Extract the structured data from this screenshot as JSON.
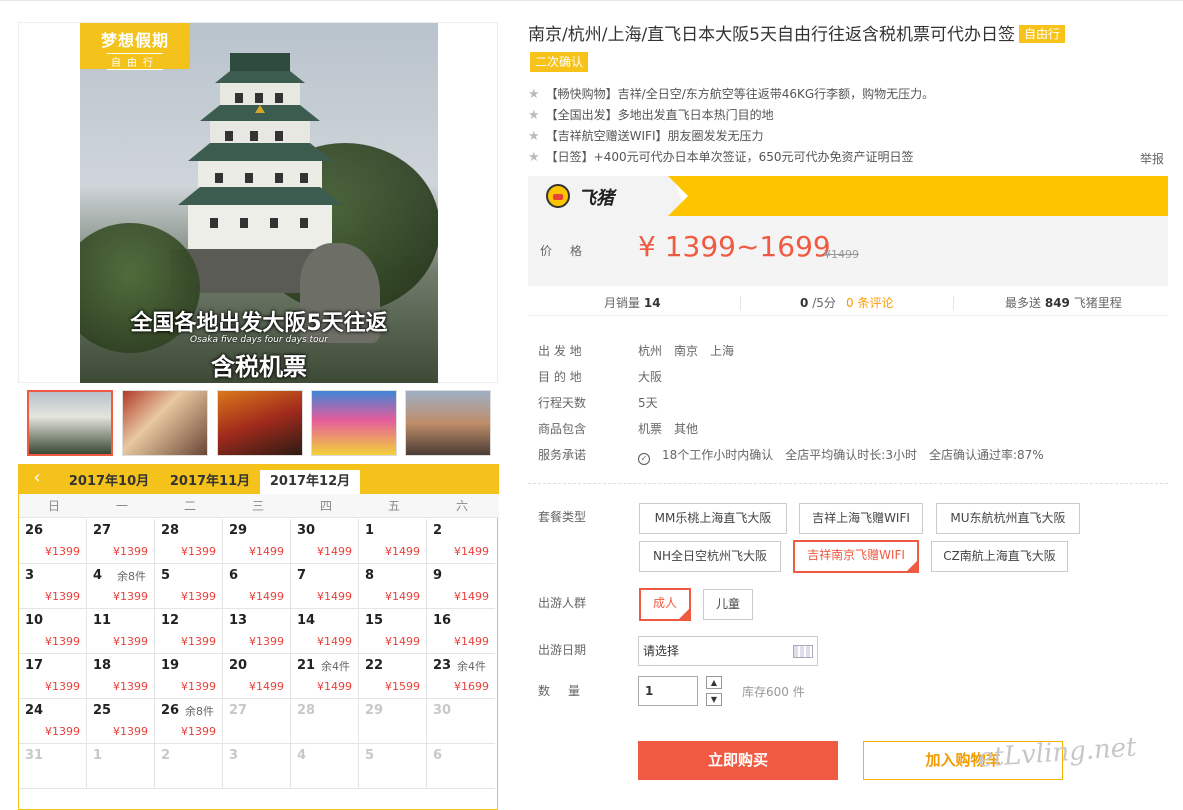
{
  "gallery": {
    "badge_line1": "梦想假期",
    "badge_line2": "自由行",
    "overlay_line1": "全国各地出发大阪5天往返",
    "overlay_line2": "Osaka five days four days tour",
    "overlay_line3": "含税机票"
  },
  "calendar": {
    "prev_icon": "chevron-left-icon",
    "tabs": [
      "2017年10月",
      "2017年11月",
      "2017年12月"
    ],
    "active_tab": "2017年12月",
    "weekdays": [
      "日",
      "一",
      "二",
      "三",
      "四",
      "五",
      "六"
    ],
    "days": [
      {
        "d": "26",
        "price": "¥1399"
      },
      {
        "d": "27",
        "price": "¥1399"
      },
      {
        "d": "28",
        "price": "¥1399"
      },
      {
        "d": "29",
        "price": "¥1499"
      },
      {
        "d": "30",
        "price": "¥1499"
      },
      {
        "d": "1",
        "price": "¥1499"
      },
      {
        "d": "2",
        "price": "¥1499"
      },
      {
        "d": "3",
        "price": "¥1399"
      },
      {
        "d": "4",
        "stock": "余8件",
        "price": "¥1399"
      },
      {
        "d": "5",
        "price": "¥1399"
      },
      {
        "d": "6",
        "price": "¥1499"
      },
      {
        "d": "7",
        "price": "¥1499"
      },
      {
        "d": "8",
        "price": "¥1499"
      },
      {
        "d": "9",
        "price": "¥1499"
      },
      {
        "d": "10",
        "price": "¥1399"
      },
      {
        "d": "11",
        "price": "¥1399"
      },
      {
        "d": "12",
        "price": "¥1399"
      },
      {
        "d": "13",
        "price": "¥1399"
      },
      {
        "d": "14",
        "price": "¥1499"
      },
      {
        "d": "15",
        "price": "¥1499"
      },
      {
        "d": "16",
        "price": "¥1499"
      },
      {
        "d": "17",
        "price": "¥1399"
      },
      {
        "d": "18",
        "price": "¥1399"
      },
      {
        "d": "19",
        "price": "¥1399"
      },
      {
        "d": "20",
        "price": "¥1499"
      },
      {
        "d": "21",
        "stock": "余4件",
        "price": "¥1499"
      },
      {
        "d": "22",
        "price": "¥1599"
      },
      {
        "d": "23",
        "stock": "余4件",
        "price": "¥1699"
      },
      {
        "d": "24",
        "price": "¥1399"
      },
      {
        "d": "25",
        "price": "¥1399"
      },
      {
        "d": "26",
        "stock": "余8件",
        "price": "¥1399"
      },
      {
        "d": "27",
        "disabled": true
      },
      {
        "d": "28",
        "disabled": true
      },
      {
        "d": "29",
        "disabled": true
      },
      {
        "d": "30",
        "disabled": true
      },
      {
        "d": "31",
        "disabled": true
      },
      {
        "d": "1",
        "disabled": true
      },
      {
        "d": "2",
        "disabled": true
      },
      {
        "d": "3",
        "disabled": true
      },
      {
        "d": "4",
        "disabled": true
      },
      {
        "d": "5",
        "disabled": true
      },
      {
        "d": "6",
        "disabled": true
      }
    ]
  },
  "product": {
    "title": "南京/杭州/上海/直飞日本大阪5天自由行往返含税机票可代办日签",
    "tag_type": "自由行",
    "tag_confirm": "二次确认",
    "features": [
      "【畅快购物】吉祥/全日空/东方航空等往返带46KG行李额，购物无压力。",
      "【全国出发】多地出发直飞日本热门目的地",
      "【吉祥航空赠送WIFI】朋友圈发发无压力",
      "【日签】+400元可代办日本单次签证，650元可代办免资产证明日签"
    ],
    "report": "举报",
    "brand": "飞猪",
    "price_label": "价格",
    "price": "¥ 1399~1699",
    "price_old": "¥1499",
    "stats": {
      "sales_label": "月销量",
      "sales_value": "14",
      "rating_value": "0",
      "rating_suffix": "/5分",
      "reviews": "0 条评论",
      "miles_prefix": "最多送",
      "miles_value": "849",
      "miles_suffix": "飞猪里程"
    }
  },
  "info": {
    "rows": [
      {
        "k": "出 发 地",
        "v": [
          "杭州",
          "南京",
          "上海"
        ]
      },
      {
        "k": "目 的 地",
        "v": [
          "大阪"
        ]
      },
      {
        "k": "行程天数",
        "v": [
          "5天"
        ]
      },
      {
        "k": "商品包含",
        "v": [
          "机票",
          "其他"
        ]
      }
    ],
    "service_label": "服务承诺",
    "service_items": [
      "18个工作小时内确认",
      "全店平均确认时长:3小时",
      "全店确认通过率:87%"
    ]
  },
  "options": {
    "package_label": "套餐类型",
    "packages": [
      "MM乐桃上海直飞大阪",
      "吉祥上海飞赠WIFI",
      "MU东航杭州直飞大阪",
      "NH全日空杭州飞大阪",
      "吉祥南京飞赠WIFI",
      "CZ南航上海直飞大阪"
    ],
    "package_selected": "吉祥南京飞赠WIFI",
    "people_label": "出游人群",
    "people": [
      "成人",
      "儿童"
    ],
    "people_selected": "成人",
    "date_label": "出游日期",
    "date_placeholder": "请选择",
    "qty_label": "数量",
    "qty_value": "1",
    "stock": "库存600 件",
    "buy": "立即购买",
    "cart": "加入购物车"
  },
  "watermark": "etLvling.net"
}
